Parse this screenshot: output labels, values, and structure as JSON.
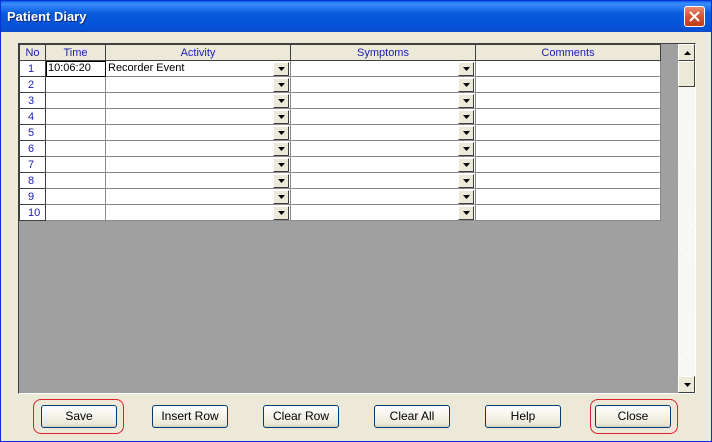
{
  "window": {
    "title": "Patient Diary"
  },
  "grid": {
    "columns": [
      "No",
      "Time",
      "Activity",
      "Symptoms",
      "Comments"
    ],
    "rows": [
      {
        "no": "1",
        "time": "10:06:20",
        "activity": "Recorder Event",
        "symptoms": "",
        "comments": ""
      },
      {
        "no": "2",
        "time": "",
        "activity": "",
        "symptoms": "",
        "comments": ""
      },
      {
        "no": "3",
        "time": "",
        "activity": "",
        "symptoms": "",
        "comments": ""
      },
      {
        "no": "4",
        "time": "",
        "activity": "",
        "symptoms": "",
        "comments": ""
      },
      {
        "no": "5",
        "time": "",
        "activity": "",
        "symptoms": "",
        "comments": ""
      },
      {
        "no": "6",
        "time": "",
        "activity": "",
        "symptoms": "",
        "comments": ""
      },
      {
        "no": "7",
        "time": "",
        "activity": "",
        "symptoms": "",
        "comments": ""
      },
      {
        "no": "8",
        "time": "",
        "activity": "",
        "symptoms": "",
        "comments": ""
      },
      {
        "no": "9",
        "time": "",
        "activity": "",
        "symptoms": "",
        "comments": ""
      },
      {
        "no": "10",
        "time": "",
        "activity": "",
        "symptoms": "",
        "comments": ""
      }
    ]
  },
  "buttons": {
    "save": "Save",
    "insert_row": "Insert Row",
    "clear_row": "Clear Row",
    "clear_all": "Clear All",
    "help": "Help",
    "close": "Close"
  },
  "colors": {
    "title_bar": "#0a5bdc",
    "header_text": "#1c1cb4",
    "highlight_ring": "#e0202a"
  }
}
